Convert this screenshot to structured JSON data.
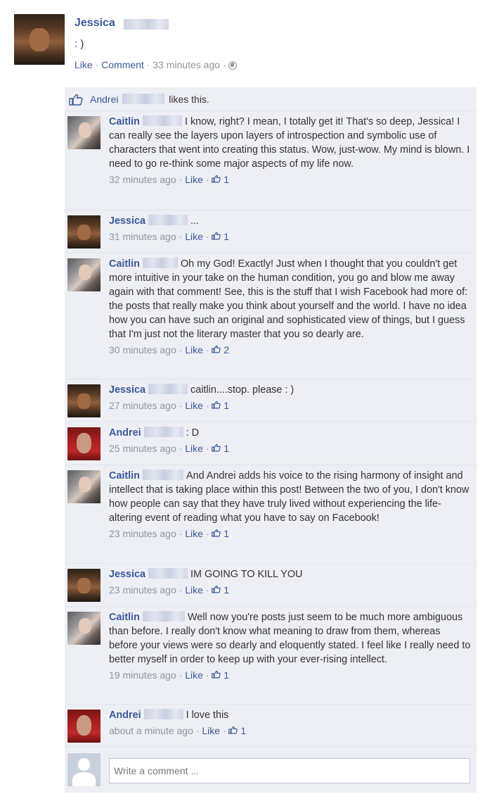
{
  "post": {
    "author": "Jessica",
    "text": ": )",
    "actions": {
      "like": "Like",
      "comment": "Comment",
      "time": "33 minutes ago",
      "privacy_icon": "globe-icon"
    }
  },
  "likes": {
    "name": "Andrei",
    "suffix": "likes this."
  },
  "comments": [
    {
      "author": "Caitlin",
      "avatar": "caitlin",
      "text": "I know, right? I mean, I totally get it! That's so deep, Jessica! I can really see the layers upon layers of introspection and symbolic use of characters that went into creating this status. Wow, just-wow. My mind is blown. I need to go re-think some major aspects of my life now.",
      "time": "32 minutes ago",
      "like": "Like",
      "likes": "1"
    },
    {
      "author": "Jessica",
      "avatar": "jessica",
      "text": "...",
      "time": "31 minutes ago",
      "like": "Like",
      "likes": "1"
    },
    {
      "author": "Caitlin",
      "avatar": "caitlin",
      "text": "Oh my God! Exactly! Just when I thought that you couldn't get more intuitive in your take on the human condition, you go and blow me away again with that comment! See, this is the stuff that I wish Facebook had more of: the posts that really make you think about yourself and the world. I have no idea how you can have such an original and sophisticated view of things, but I guess that I'm just not the literary master that you so dearly are.",
      "time": "30 minutes ago",
      "like": "Like",
      "likes": "2"
    },
    {
      "author": "Jessica",
      "avatar": "jessica",
      "text": "caitlin....stop. please : )",
      "time": "27 minutes ago",
      "like": "Like",
      "likes": "1"
    },
    {
      "author": "Andrei",
      "avatar": "andrei",
      "text": ": D",
      "time": "25 minutes ago",
      "like": "Like",
      "likes": "1"
    },
    {
      "author": "Caitlin",
      "avatar": "caitlin",
      "text": "And Andrei adds his voice to the rising harmony of insight and intellect that is taking place within this post! Between the two of you, I don't know how people can say that they have truly lived without experiencing the life-altering event of reading what you have to say on Facebook!",
      "time": "23 minutes ago",
      "like": "Like",
      "likes": "1"
    },
    {
      "author": "Jessica",
      "avatar": "jessica",
      "text": "IM GOING TO KILL YOU",
      "time": "23 minutes ago",
      "like": "Like",
      "likes": "1"
    },
    {
      "author": "Caitlin",
      "avatar": "caitlin",
      "text": "Well now you're posts just seem to be much more ambiguous than before. I really don't know what meaning to draw from them, whereas before your views were so dearly and eloquently stated. I feel like I really need to better myself in order to keep up with your ever-rising intellect.",
      "time": "19 minutes ago",
      "like": "Like",
      "likes": "1"
    },
    {
      "author": "Andrei",
      "avatar": "andrei",
      "text": "I love this",
      "time": "about a minute ago",
      "like": "Like",
      "likes": "1"
    }
  ],
  "write": {
    "placeholder": "Write a comment ..."
  },
  "colors": {
    "link": "#3b5998",
    "panel": "#edeff4",
    "meta": "#90949c"
  }
}
